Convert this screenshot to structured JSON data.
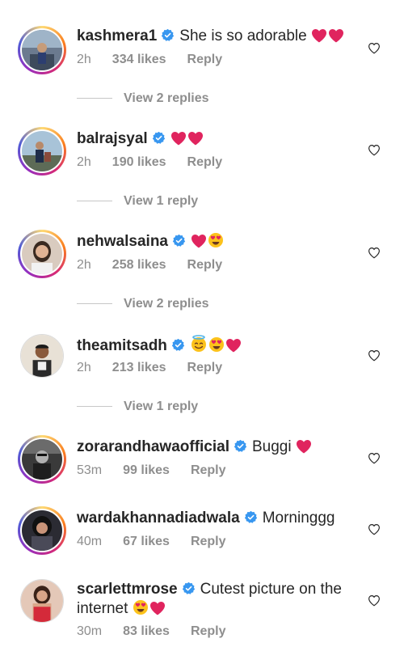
{
  "comments": [
    {
      "username": "kashmera1",
      "verified": true,
      "text": "She is so adorable",
      "emojis": [
        "red-heart",
        "red-heart"
      ],
      "time": "2h",
      "likes": "334 likes",
      "reply_label": "Reply",
      "view_replies": "View 2 replies"
    },
    {
      "username": "balrajsyal",
      "verified": true,
      "text": "",
      "emojis": [
        "red-heart",
        "red-heart"
      ],
      "time": "2h",
      "likes": "190 likes",
      "reply_label": "Reply",
      "view_replies": "View 1 reply"
    },
    {
      "username": "nehwalsaina",
      "verified": true,
      "text": "",
      "emojis": [
        "red-heart",
        "heart-eyes-face"
      ],
      "time": "2h",
      "likes": "258 likes",
      "reply_label": "Reply",
      "view_replies": "View 2 replies"
    },
    {
      "username": "theamitsadh",
      "verified": true,
      "text": "",
      "emojis": [
        "halo-face",
        "heart-eyes-face",
        "red-heart"
      ],
      "time": "2h",
      "likes": "213 likes",
      "reply_label": "Reply",
      "view_replies": "View 1 reply"
    },
    {
      "username": "zorarandhawaofficial",
      "verified": true,
      "text": "Buggi",
      "emojis": [
        "red-heart"
      ],
      "time": "53m",
      "likes": "99 likes",
      "reply_label": "Reply",
      "view_replies": ""
    },
    {
      "username": "wardakhannadiadwala",
      "verified": true,
      "text": "Morninggg",
      "emojis": [],
      "time": "40m",
      "likes": "67 likes",
      "reply_label": "Reply",
      "view_replies": ""
    },
    {
      "username": "scarlettmrose",
      "verified": true,
      "text": "Cutest picture on the",
      "text_line2": "internet",
      "emojis": [
        "heart-eyes-face",
        "red-heart"
      ],
      "time": "30m",
      "likes": "83 likes",
      "reply_label": "Reply",
      "view_replies": ""
    }
  ],
  "colors": {
    "verified_blue": "#3897f0",
    "heart_red": "#e0245e",
    "meta_gray": "#8e8e8e",
    "text": "#262626"
  },
  "icons": {
    "like": "heart-outline-icon",
    "verified": "verified-badge-icon"
  }
}
